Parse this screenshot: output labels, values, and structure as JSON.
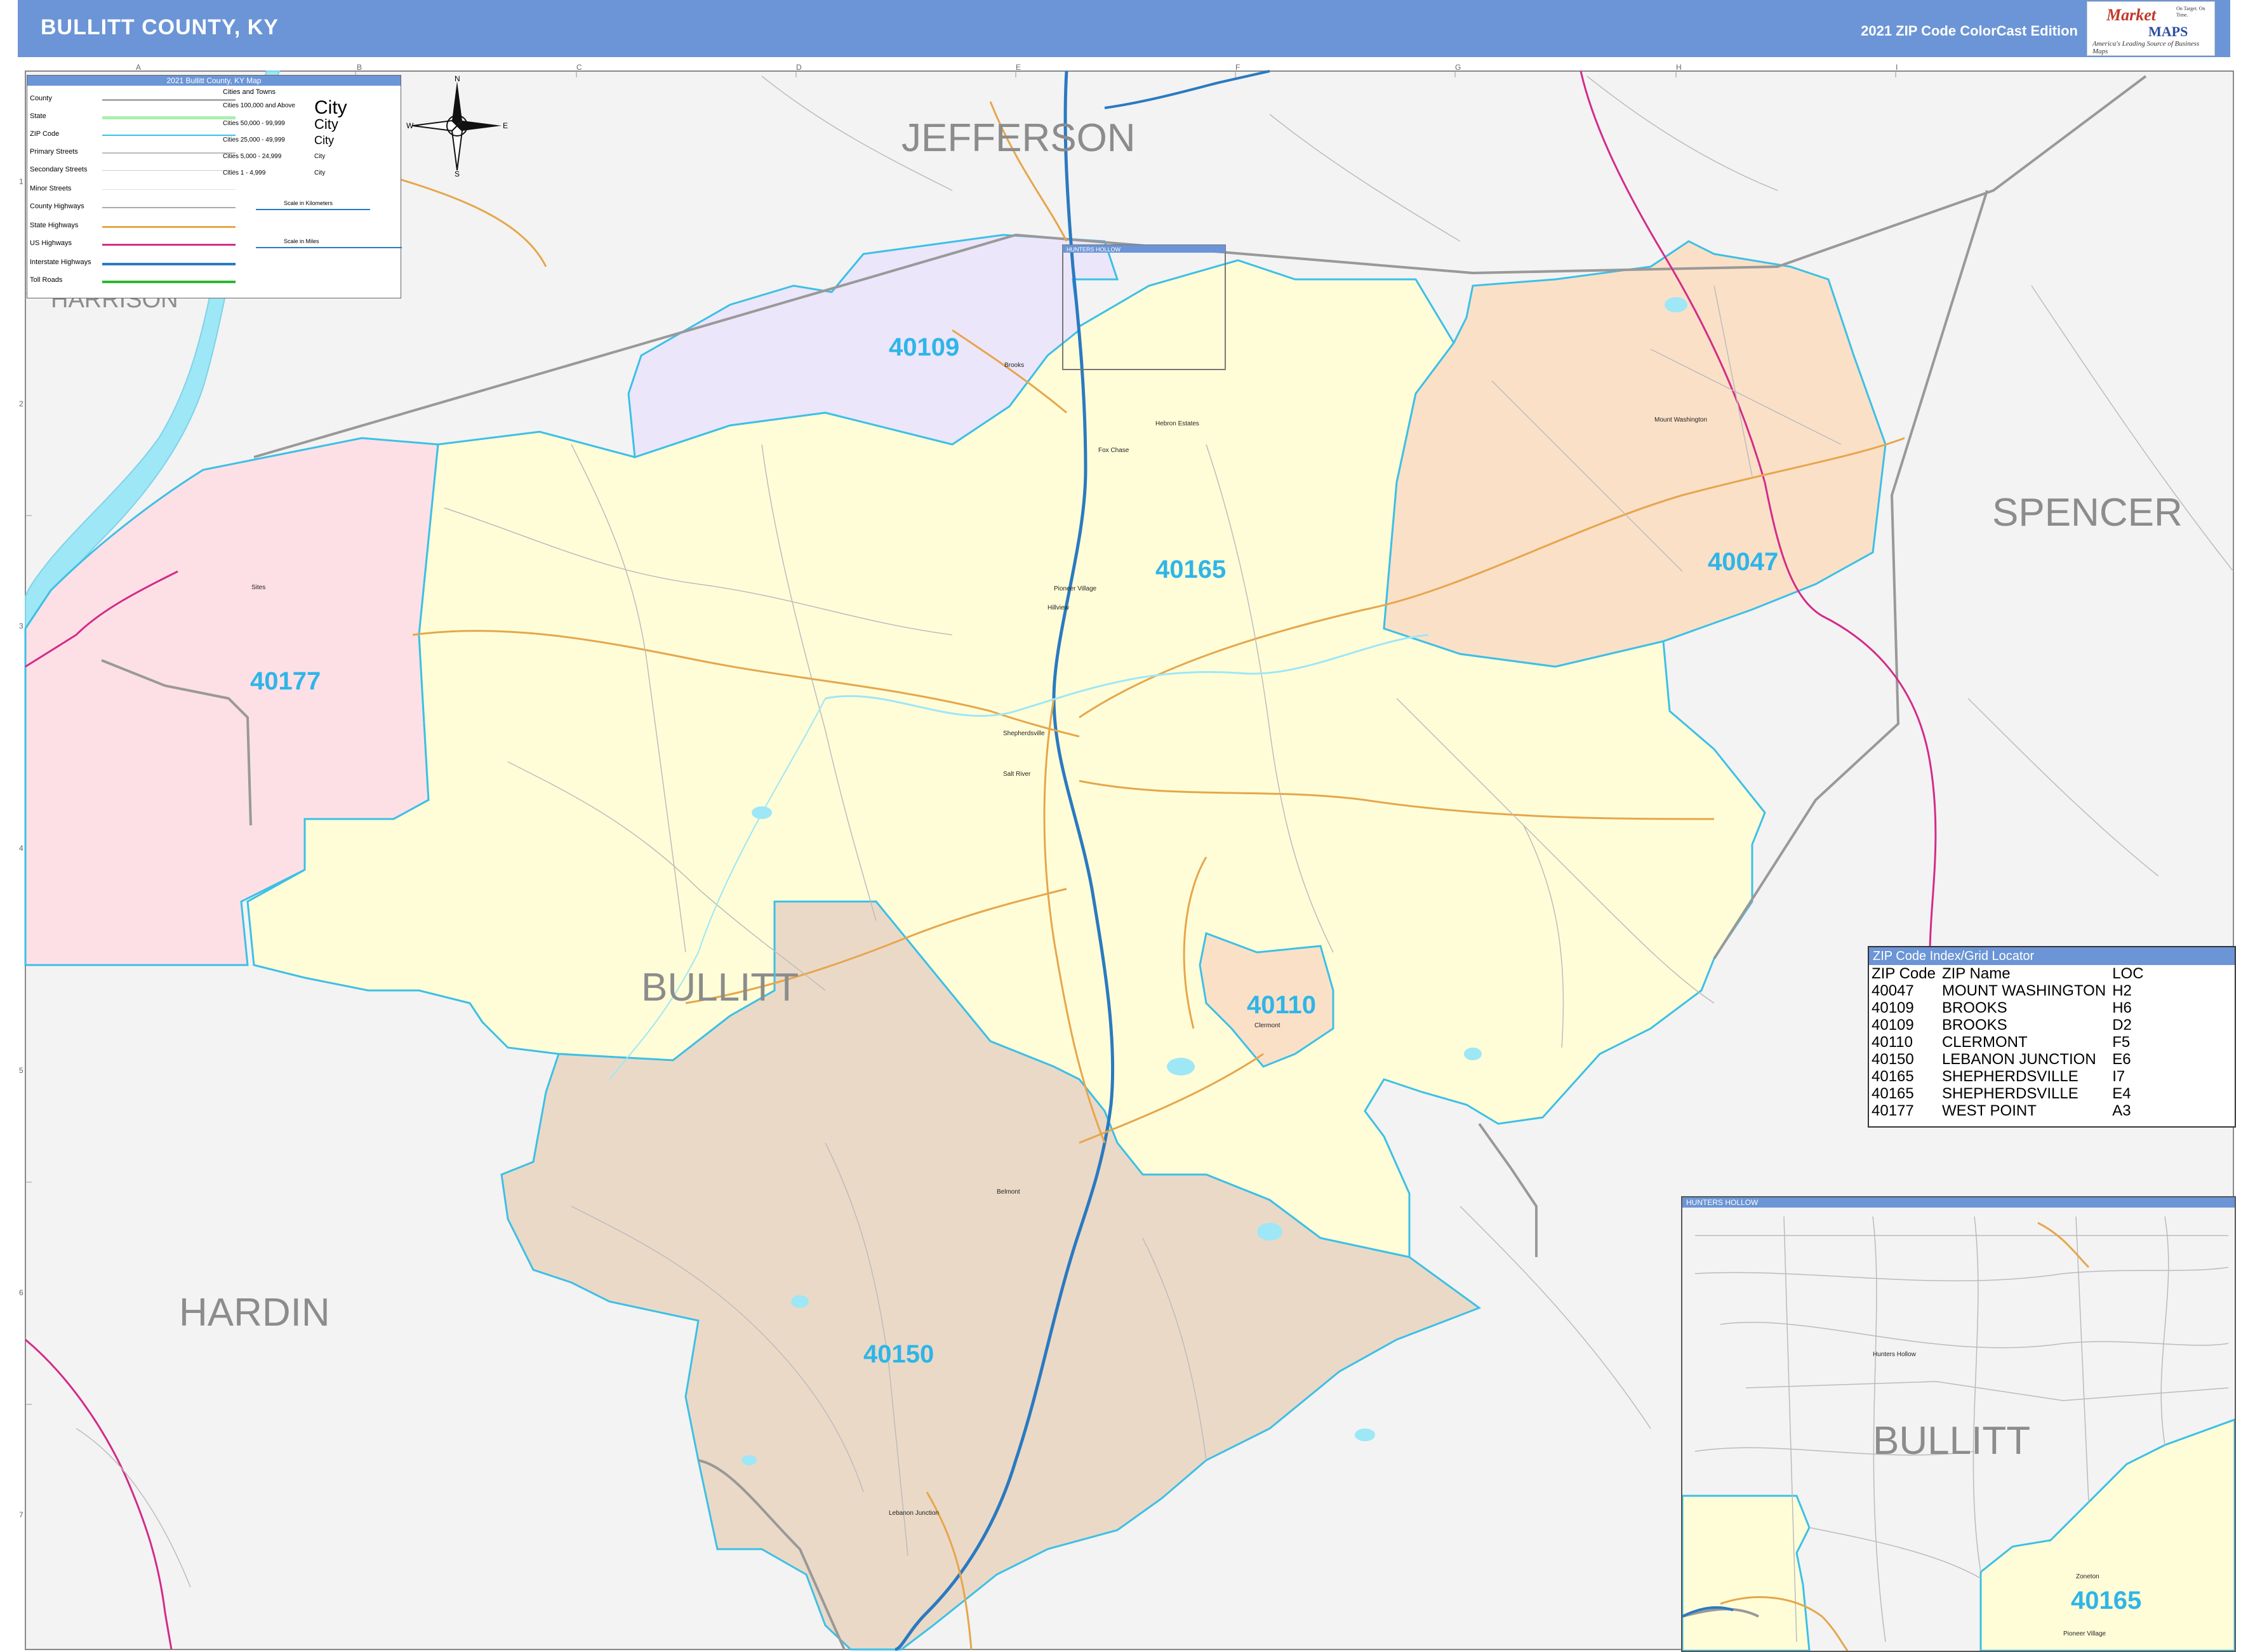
{
  "header": {
    "title": "BULLITT COUNTY, KY",
    "edition": "2021 ZIP Code ColorCast Edition",
    "logo_brand_a": "Market",
    "logo_brand_b": "MAPS",
    "logo_tagline": "America's Leading Source of Business Maps",
    "logo_slogan": "On Target. On Time."
  },
  "colors": {
    "header": "#6b95d6",
    "zip_40109": "#ece6fb",
    "zip_40165": "#fffdd8",
    "zip_40047": "#fbe0c8",
    "zip_40177": "#fde0e6",
    "zip_40110": "#fbe0c8",
    "zip_40150": "#ebd9c8",
    "water": "#9ee7f6",
    "zip_border": "#3cc0e6",
    "interstate": "#2a7ac0",
    "us_highway": "#d42b8a",
    "state_highway": "#e6a64c",
    "county_line": "#999999"
  },
  "counties": {
    "jefferson": "JEFFERSON",
    "spencer": "SPENCER",
    "bullitt": "BULLITT",
    "hardin": "HARDIN",
    "harrison": "HARRISON"
  },
  "zips": {
    "z40109": "40109",
    "z40165": "40165",
    "z40047": "40047",
    "z40177": "40177",
    "z40110": "40110",
    "z40150": "40150"
  },
  "cities": {
    "brooks": "Brooks",
    "hebron_estates": "Hebron Estates",
    "fox_chase": "Fox Chase",
    "mount_washington": "Mount Washington",
    "pioneer_village": "Pioneer Village",
    "hunters_hollow": "Hunters Hollow",
    "hillview": "Hillview",
    "shepherdsville": "Shepherdsville",
    "salt_river": "Salt River",
    "clermont": "Clermont",
    "belmont": "Belmont",
    "lebanon_junction": "Lebanon Junction",
    "lebanon_junction_2": "Lebanon Junction",
    "sites": "Sites",
    "zoneton": "Zoneton"
  },
  "grid": {
    "cols": [
      "A",
      "B",
      "C",
      "D",
      "E",
      "F",
      "G",
      "H",
      "I"
    ],
    "rows": [
      "1",
      "2",
      "3",
      "4",
      "5",
      "6",
      "7"
    ]
  },
  "legend": {
    "title": "2021 Bullitt County, KY Map",
    "county": "County",
    "state": "State",
    "zip": "ZIP Code",
    "primary": "Primary Streets",
    "secondary": "Secondary Streets",
    "minor": "Minor Streets",
    "county_hwy": "County Highways",
    "state_hwy": "State Highways",
    "us_hwy": "US Highways",
    "interstate": "Interstate Highways",
    "toll": "Toll Roads",
    "cities_title": "Cities and Towns",
    "c1": "Cities 100,000 and Above",
    "c2": "Cities 50,000 - 99,999",
    "c3": "Cities 25,000 - 49,999",
    "c4": "Cities 5,000 - 24,999",
    "c5": "Cities 1 - 4,999",
    "s1": "City",
    "s2": "City",
    "s3": "City",
    "s4": "City",
    "s5": "City",
    "scale_km": "Scale in Kilometers",
    "scale_mi": "Scale in Miles"
  },
  "compass": {
    "n": "N",
    "s": "S",
    "e": "E",
    "w": "W"
  },
  "zip_index": {
    "title": "ZIP Code Index/Grid Locator",
    "headers": [
      "ZIP Code",
      "ZIP Name",
      "LOC"
    ],
    "rows": [
      [
        "40047",
        "MOUNT WASHINGTON",
        "H2"
      ],
      [
        "40109",
        "BROOKS",
        "H6"
      ],
      [
        "40109",
        "BROOKS",
        "D2"
      ],
      [
        "40110",
        "CLERMONT",
        "F5"
      ],
      [
        "40150",
        "LEBANON JUNCTION",
        "E6"
      ],
      [
        "40165",
        "SHEPHERDSVILLE",
        "I7"
      ],
      [
        "40165",
        "SHEPHERDSVILLE",
        "E4"
      ],
      [
        "40177",
        "WEST POINT",
        "A3"
      ]
    ]
  },
  "inset": {
    "title": "HUNTERS HOLLOW",
    "county": "BULLITT",
    "zip": "40165",
    "city1": "Hunters Hollow",
    "city2": "Zoneton",
    "city3": "Pioneer Village"
  },
  "inset_box_label": "HUNTERS HOLLOW"
}
